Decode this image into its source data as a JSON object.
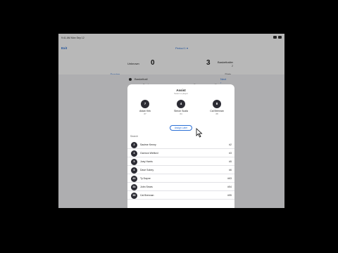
{
  "status": {
    "time": "9:41 AM   Mon Sep 12"
  },
  "appbar": {
    "back_label": "Exit",
    "period_label": "Period 1 ▾",
    "home": {
      "name": "Unknown",
      "score": "0"
    },
    "away": {
      "name": "Basketballer",
      "record": "2",
      "score": "3"
    },
    "tabs": [
      {
        "label": "Scoring"
      },
      {
        "label": "Stats"
      }
    ]
  },
  "background": {
    "row_label": "Basketball",
    "next_label": "Next ›",
    "stat_left": "Foul",
    "stat_mid": "+3",
    "stat_right": "+3"
  },
  "modal": {
    "title": "Assist",
    "subtitle": "Select a player",
    "selected": [
      {
        "number": "7",
        "name": "Aidan Kirk",
        "tag": "#7"
      },
      {
        "number": "4",
        "name": "Simon Scala",
        "tag": "#4"
      },
      {
        "number": "8",
        "name": "Cal Brennan",
        "tag": "#8"
      }
    ],
    "reassign_label": "Assign Later",
    "search_label": "Search",
    "players": [
      {
        "number": "2",
        "name": "Saoirse Kenny",
        "tag": "#2"
      },
      {
        "number": "3",
        "name": "Garmon Welford",
        "tag": "#3"
      },
      {
        "number": "5",
        "name": "Joey Harris",
        "tag": "#5"
      },
      {
        "number": "6",
        "name": "Dave Sobey",
        "tag": "#6"
      },
      {
        "number": "63",
        "name": "Ty Dayne",
        "tag": "#63"
      },
      {
        "number": "54",
        "name": "John Sears",
        "tag": "#54"
      },
      {
        "number": "55",
        "name": "Cal Brennan",
        "tag": "#55"
      }
    ]
  }
}
